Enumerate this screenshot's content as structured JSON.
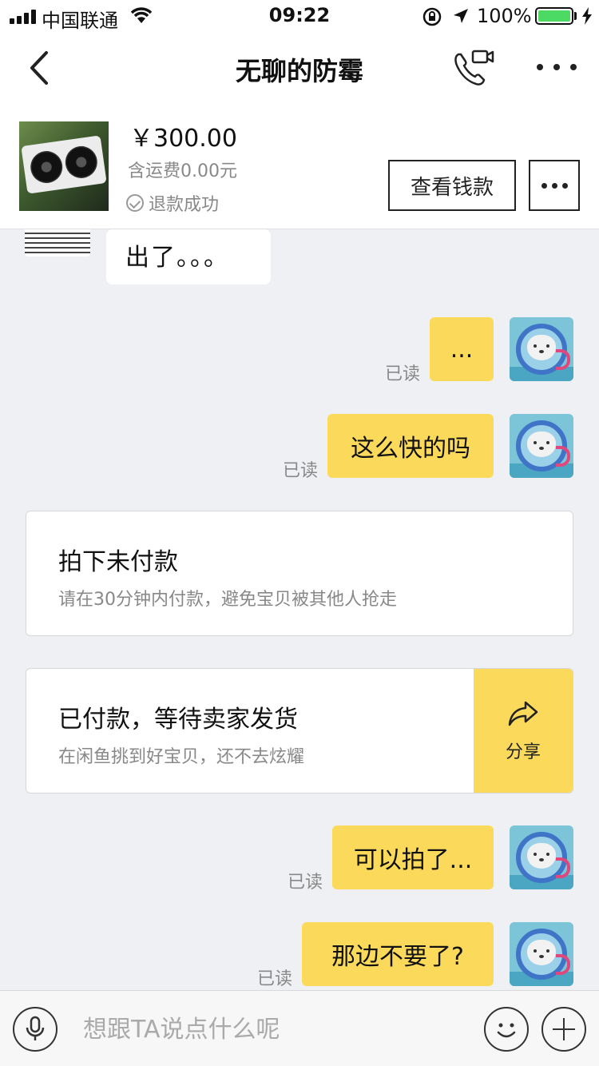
{
  "status_bar": {
    "carrier": "中国联通",
    "time": "09:22",
    "battery_percent": "100%",
    "battery_level": 1.0,
    "icons": [
      "signal-icon",
      "wifi-icon",
      "rotation-lock-icon",
      "location-icon",
      "battery-icon",
      "charging-icon"
    ]
  },
  "nav": {
    "title": "无聊的防霉",
    "icons": [
      "back-icon",
      "video-call-icon",
      "more-icon"
    ]
  },
  "product": {
    "price": "￥300.00",
    "shipping": "含运费0.00元",
    "status": "退款成功",
    "view_money_button": "查看钱款"
  },
  "chat": {
    "peer_message": "出了。。。",
    "messages": [
      {
        "text": "...",
        "read": "已读"
      },
      {
        "text": "这么快的吗",
        "read": "已读"
      },
      {
        "text": "可以拍了...",
        "read": "已读"
      },
      {
        "text": "那边不要了?",
        "read": "已读"
      }
    ],
    "card_unpaid": {
      "title": "拍下未付款",
      "subtitle": "请在30分钟内付款，避免宝贝被其他人抢走"
    },
    "card_paid": {
      "title": "已付款，等待卖家发货",
      "subtitle": "在闲鱼挑到好宝贝，还不去炫耀",
      "share_label": "分享"
    }
  },
  "input_bar": {
    "placeholder": "想跟TA说点什么呢"
  },
  "colors": {
    "accent_yellow": "#fbda5b",
    "background": "#eff0f4",
    "battery_green": "#4cd964"
  }
}
